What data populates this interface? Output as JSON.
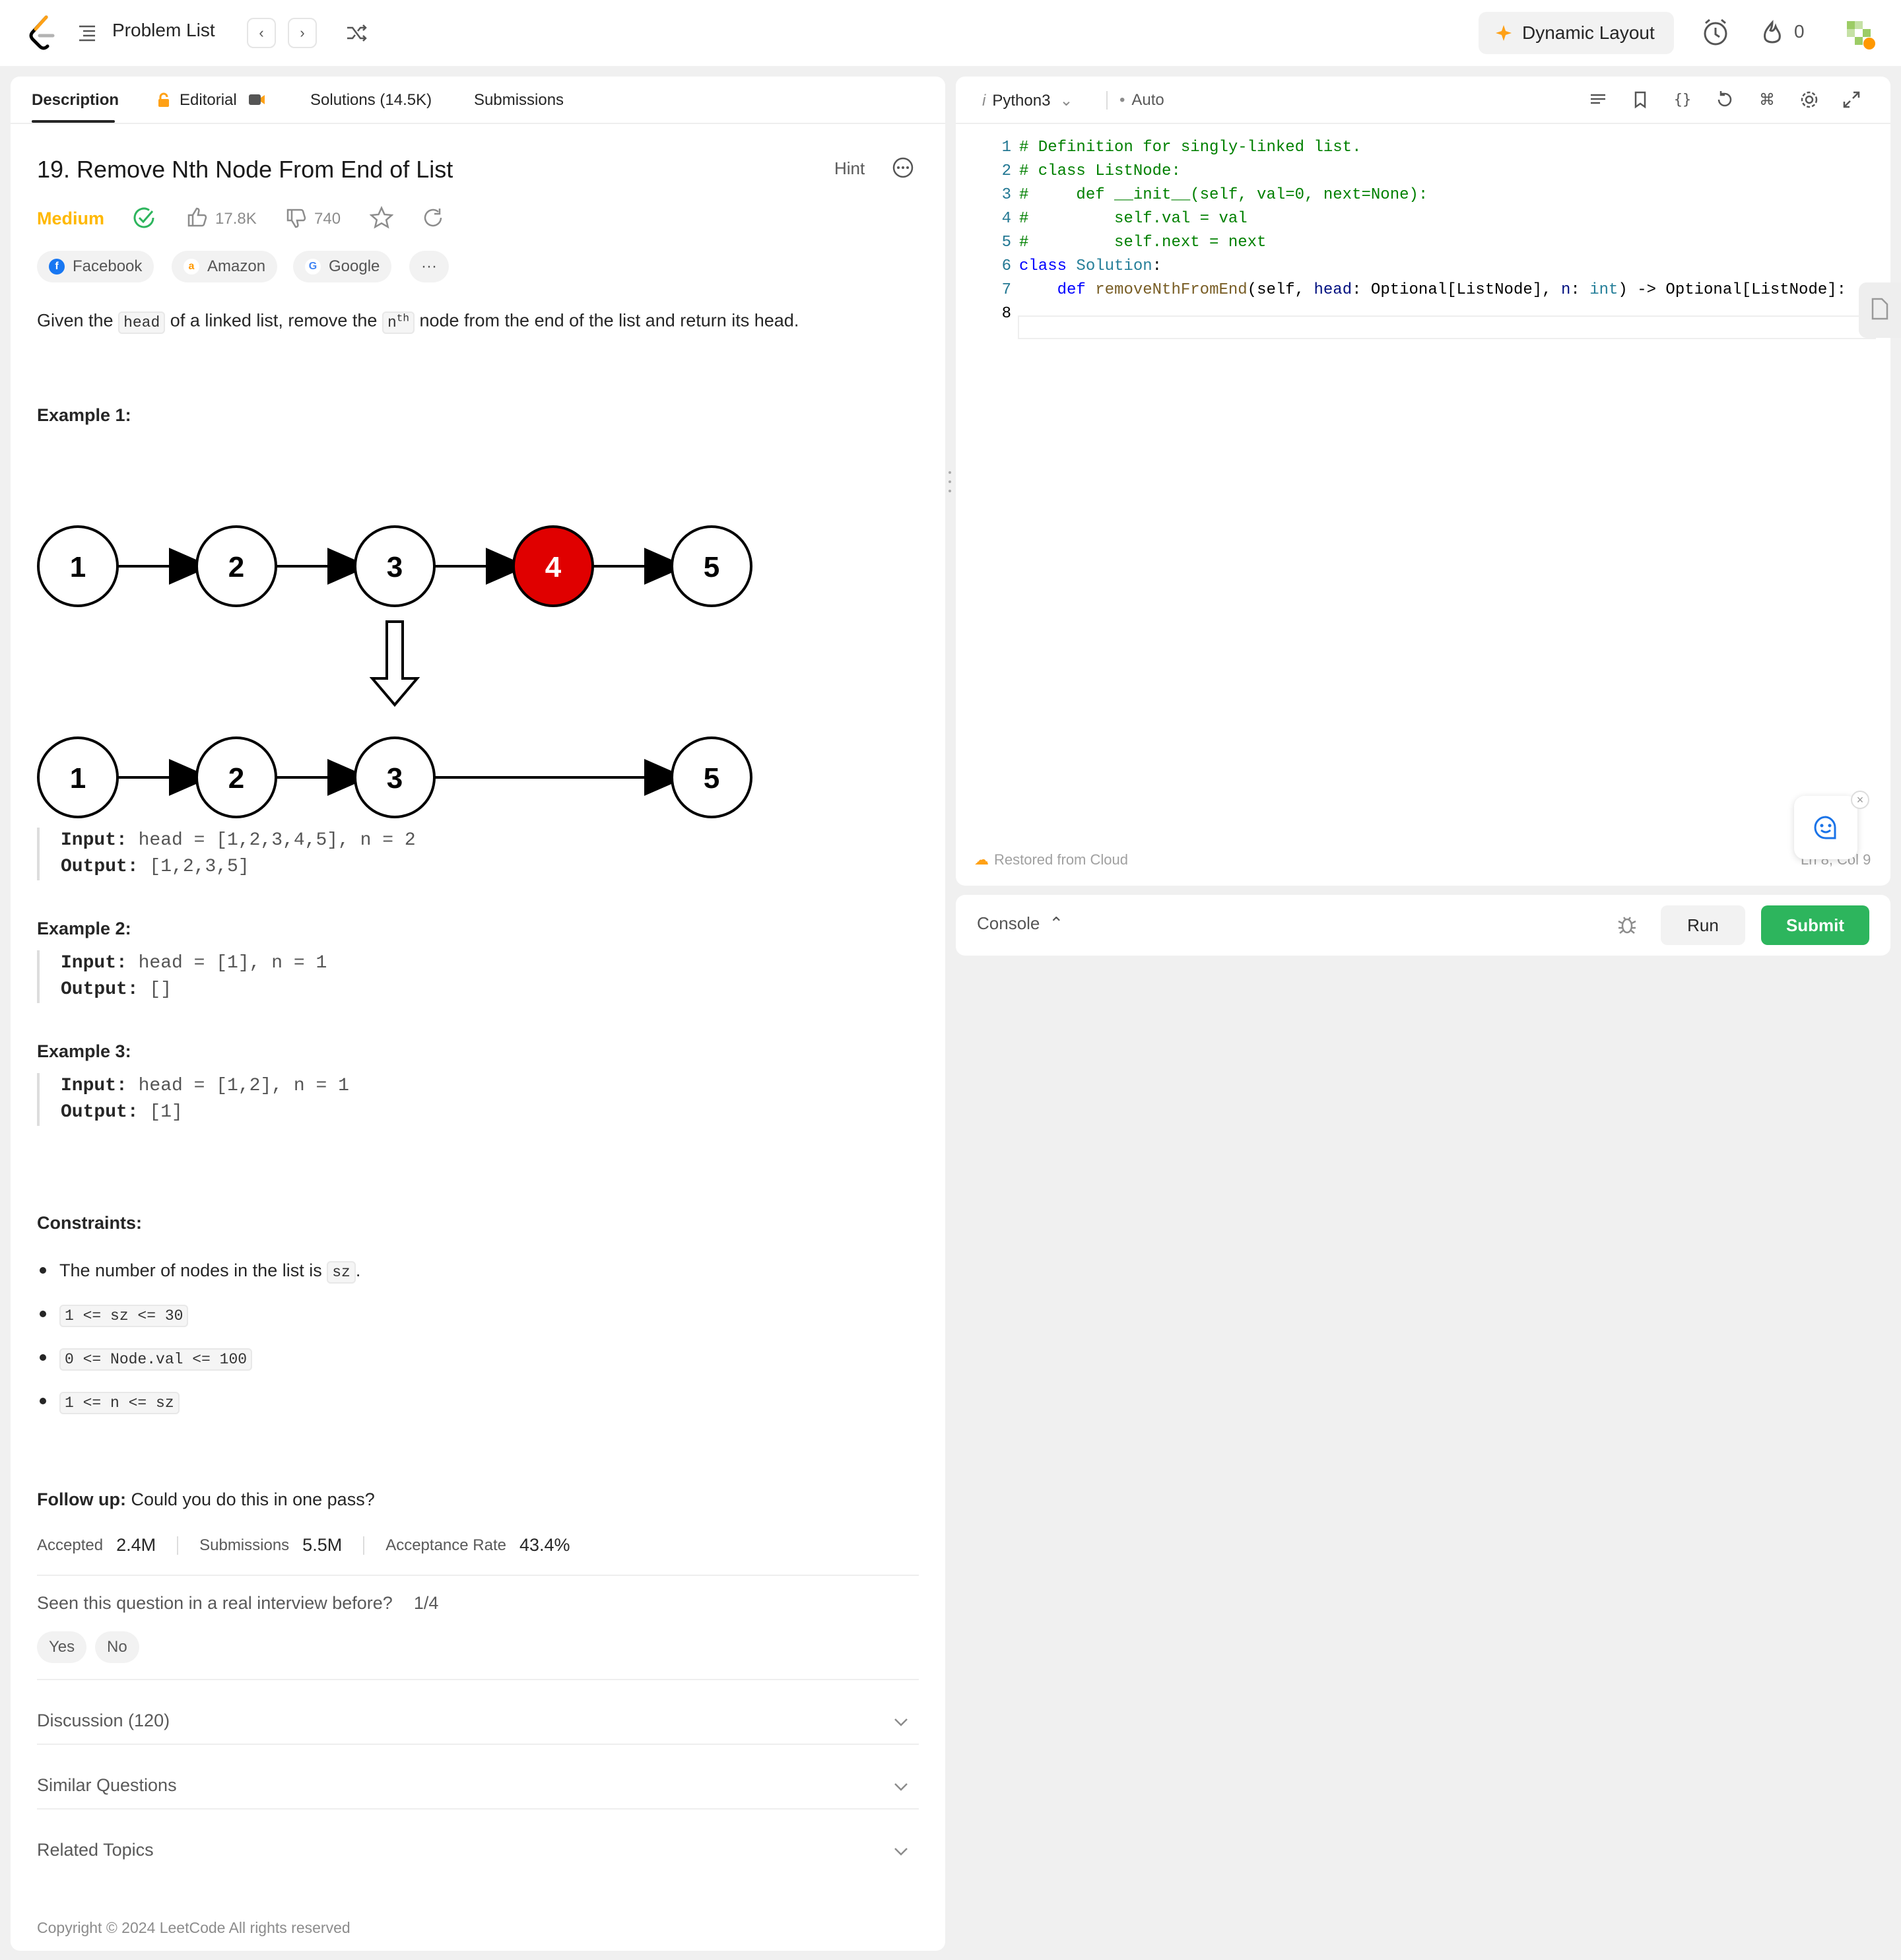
{
  "topbar": {
    "problem_list_label": "Problem List",
    "dynamic_layout_label": "Dynamic Layout",
    "streak_count": "0"
  },
  "tabs": {
    "description": "Description",
    "editorial": "Editorial",
    "solutions": "Solutions (14.5K)",
    "submissions": "Submissions"
  },
  "problem": {
    "title": "19. Remove Nth Node From End of List",
    "hint_label": "Hint",
    "difficulty": "Medium",
    "likes": "17.8K",
    "dislikes": "740",
    "companies": [
      "Facebook",
      "Amazon",
      "Google"
    ],
    "more_companies": "···",
    "desc_pre": "Given the ",
    "desc_code1": "head",
    "desc_mid": " of a linked list, remove the ",
    "desc_code2": "n",
    "desc_sup": "th",
    "desc_post": " node from the end of the list and return its head.",
    "examples": [
      {
        "heading": "Example 1:",
        "input_label": "Input:",
        "input": " head = [1,2,3,4,5], n = 2",
        "output_label": "Output:",
        "output": " [1,2,3,5]"
      },
      {
        "heading": "Example 2:",
        "input_label": "Input:",
        "input": " head = [1], n = 1",
        "output_label": "Output:",
        "output": " []"
      },
      {
        "heading": "Example 3:",
        "input_label": "Input:",
        "input": " head = [1,2], n = 1",
        "output_label": "Output:",
        "output": " [1]"
      }
    ],
    "diagram_top_nodes": [
      "1",
      "2",
      "3",
      "4",
      "5"
    ],
    "diagram_bottom_nodes": [
      "1",
      "2",
      "3",
      "5"
    ],
    "constraints_heading": "Constraints:",
    "constraint1_pre": "The number of nodes in the list is ",
    "constraint1_code": "sz",
    "constraint1_post": ".",
    "constraint_codes": [
      "1 <= sz <= 30",
      "0 <= Node.val <= 100",
      "1 <= n <= sz"
    ],
    "followup_label": "Follow up:",
    "followup_text": " Could you do this in one pass?",
    "stats": {
      "accepted_label": "Accepted",
      "accepted": "2.4M",
      "submissions_label": "Submissions",
      "submissions": "5.5M",
      "rate_label": "Acceptance Rate",
      "rate": "43.4%"
    },
    "seen_question": "Seen this question in a real interview before?",
    "seen_count": "1/4",
    "yes": "Yes",
    "no": "No",
    "discussion": "Discussion (120)",
    "similar": "Similar Questions",
    "topics": "Related Topics",
    "copyright": "Copyright © 2024 LeetCode All rights reserved"
  },
  "editor": {
    "language": "Python3",
    "mode": "Auto",
    "line_numbers": [
      "1",
      "2",
      "3",
      "4",
      "5",
      "6",
      "7",
      "8"
    ],
    "restored": "Restored from Cloud",
    "cursor_pos": "Ln 8, Col 9"
  },
  "console": {
    "label": "Console",
    "run": "Run",
    "submit": "Submit"
  },
  "colors": {
    "medium": "#ffb800",
    "submit_green": "#2db55d",
    "highlight_node": "#e00000"
  }
}
